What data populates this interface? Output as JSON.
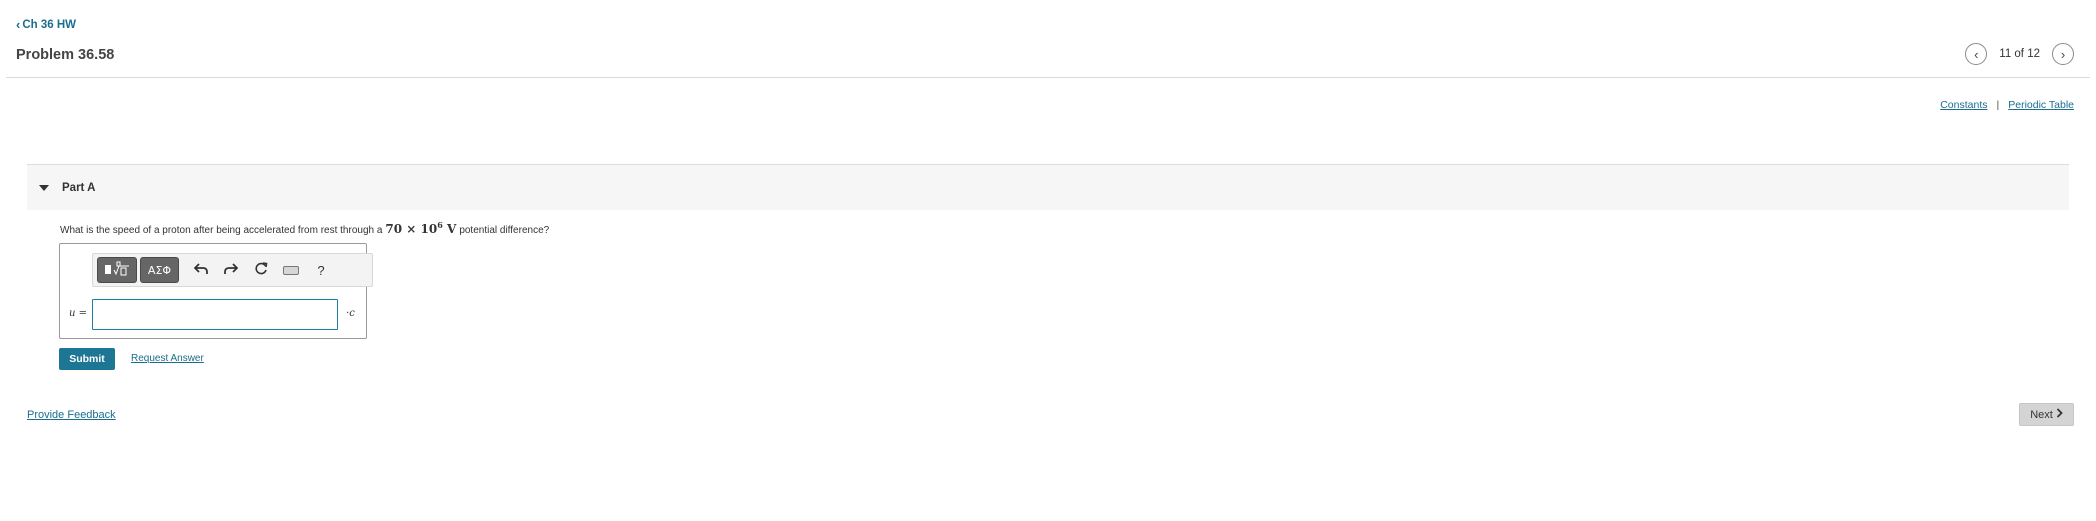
{
  "nav": {
    "back_label": "Ch 36 HW",
    "back_icon": "chevron-left-icon"
  },
  "header": {
    "title": "Problem 36.58",
    "pager_text": "11 of 12",
    "prev_icon": "chevron-left-icon",
    "next_icon": "chevron-right-icon"
  },
  "resources": {
    "constants": "Constants",
    "separator": "|",
    "periodic_table": "Periodic Table"
  },
  "part": {
    "label": "Part A",
    "question_before": "What is the speed of a proton after being accelerated from rest through a",
    "math_base": "70 × 10",
    "math_exp": "6",
    "math_unit": "V",
    "question_after": "potential difference?"
  },
  "toolbar": {
    "symbols_label": "ΑΣΦ",
    "help_label": "?",
    "icons": [
      "templates-icon",
      "greek-symbols-icon",
      "undo-icon",
      "redo-icon",
      "reset-icon",
      "keyboard-icon",
      "help-icon"
    ]
  },
  "answer": {
    "variable": "u",
    "equals": "=",
    "value": "",
    "placeholder": "",
    "unit_prefix": "·",
    "unit": "c"
  },
  "actions": {
    "submit": "Submit",
    "request_answer": "Request Answer",
    "provide_feedback": "Provide Feedback",
    "next": "Next"
  },
  "colors": {
    "link": "#1a6e8e",
    "submit_bg": "#1d7693",
    "input_border": "#1f7fa3",
    "next_bg": "#d4d4d4",
    "part_header_bg": "#f6f6f6"
  }
}
